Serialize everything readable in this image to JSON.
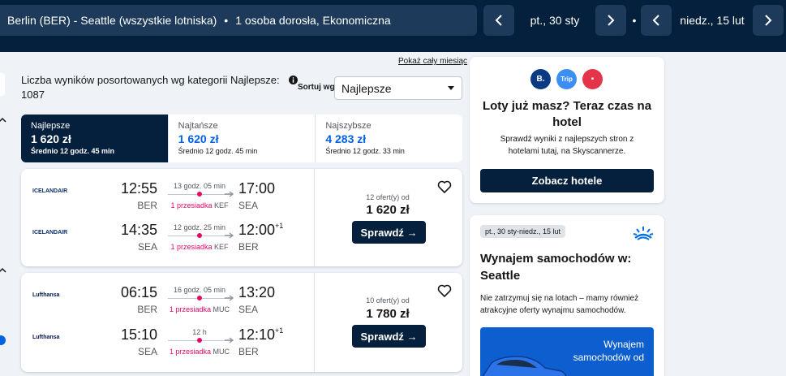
{
  "header": {
    "route": "Berlin (BER) - Seattle (wszystkie lotniska)",
    "passengers": "1 osoba dorosła, Ekonomiczna",
    "depart_date": "pt., 30 sty",
    "return_date": "niedz., 15 lut",
    "separator": "•"
  },
  "results": {
    "show_month": "Pokaż cały miesiąc",
    "count_text": "Liczba wyników posortowanych wg kategorii Najlepsze: 1087",
    "sort_label": "Sortuj wg",
    "sort_value": "Najlepsze"
  },
  "tabs": [
    {
      "label": "Najlepsze",
      "price": "1 620 zł",
      "avg": "Średnio 12 godz. 45 min"
    },
    {
      "label": "Najtańsze",
      "price": "1 620 zł",
      "avg": "Średnio 12 godz. 45 min"
    },
    {
      "label": "Najszybsze",
      "price": "4 283 zł",
      "avg": "Średnio 12 godz. 33 min"
    }
  ],
  "flights": [
    {
      "airline": "ICELANDAIR",
      "offers": "12 ofert(y) od",
      "price": "1 620 zł",
      "select_label": "Sprawdź →",
      "legs": [
        {
          "dep_time": "12:55",
          "dep_code": "BER",
          "arr_time": "17:00",
          "arr_code": "SEA",
          "plus_day": "",
          "duration": "13 godz. 05 min",
          "stops": "1 przesiadka",
          "via": "KEF"
        },
        {
          "dep_time": "14:35",
          "dep_code": "SEA",
          "arr_time": "12:00",
          "arr_code": "BER",
          "plus_day": "+1",
          "duration": "12 godz. 25 min",
          "stops": "1 przesiadka",
          "via": "KEF"
        }
      ]
    },
    {
      "airline": "Lufthansa",
      "offers": "10 ofert(y) od",
      "price": "1 780 zł",
      "select_label": "Sprawdź →",
      "legs": [
        {
          "dep_time": "06:15",
          "dep_code": "BER",
          "arr_time": "13:20",
          "arr_code": "SEA",
          "plus_day": "",
          "duration": "16 godz. 05 min",
          "stops": "1 przesiadka",
          "via": "MUC"
        },
        {
          "dep_time": "15:10",
          "dep_code": "SEA",
          "arr_time": "12:10",
          "arr_code": "BER",
          "plus_day": "+1",
          "duration": "12 h",
          "stops": "1 przesiadka",
          "via": "MUC"
        }
      ]
    }
  ],
  "hotel_ad": {
    "partners": [
      {
        "text": "B.",
        "color": "#0a3a84"
      },
      {
        "text": "Trip",
        "color": "#3b8ff3"
      },
      {
        "text": "▪",
        "color": "#e3344a"
      }
    ],
    "title": "Loty już masz? Teraz czas na hotel",
    "desc": "Sprawdź wyniki z najlepszych stron z hotelami tutaj, na Skyscannerze.",
    "button": "Zobacz hotele"
  },
  "car_ad": {
    "dates": "pt., 30 sty-niedz., 15 lut",
    "title": "Wynajem samochodów w: Seattle",
    "desc": "Nie zatrzymuj się na lotach – mamy również atrakcyjne oferty wynajmu samochodów.",
    "banner_text": "Wynajem samochodów od"
  },
  "colors": {
    "header_bg": "#05203c",
    "accent_blue": "#0062e3",
    "stop_pink": "#e70866"
  }
}
